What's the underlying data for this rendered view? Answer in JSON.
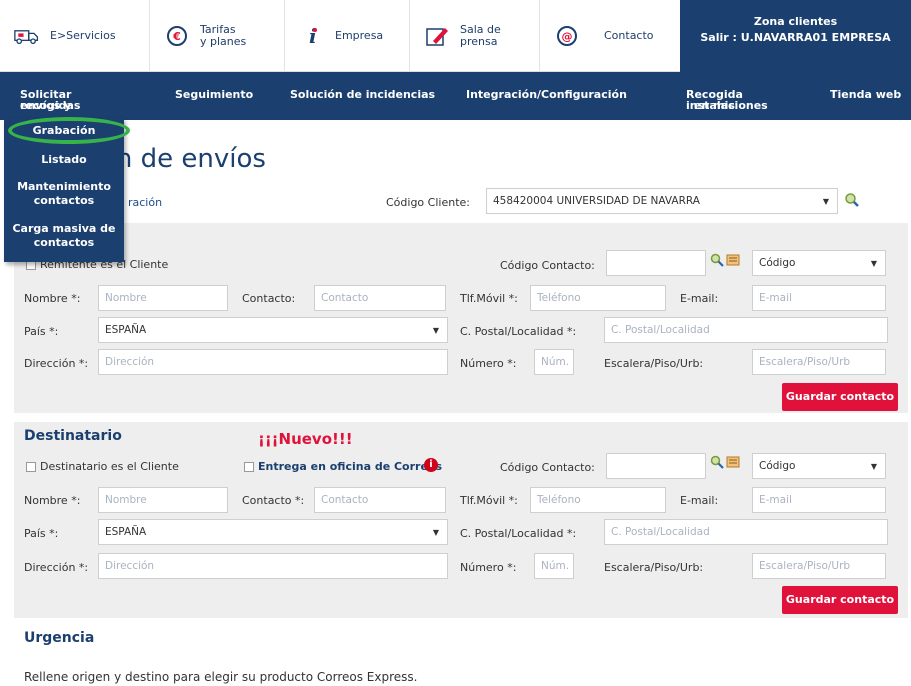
{
  "topbar": {
    "servicios": "E>Servicios",
    "tarifas_l1": "Tarifas",
    "tarifas_l2": "y planes",
    "empresa": "Empresa",
    "sala_l1": "Sala de",
    "sala_l2": "prensa",
    "contacto": "Contacto",
    "zona_title": "Zona clientes",
    "zona_user": "Salir : U.NAVARRA01 EMPRESA"
  },
  "nav": {
    "solicitar_l1": "Solicitar envíos y",
    "solicitar_l2": "recogidas",
    "seguimiento": "Seguimiento",
    "incidencias": "Solución de incidencias",
    "integracion": "Integración/Configuración",
    "recogida_l1": "Recogida en mis",
    "recogida_l2": "instalaciones",
    "tienda": "Tienda web"
  },
  "dropdown": {
    "grabacion": "Grabación",
    "listado": "Listado",
    "mantenimiento_l1": "Mantenimiento",
    "mantenimiento_l2": "contactos",
    "carga_l1": "Carga masiva de",
    "carga_l2": "contactos"
  },
  "page": {
    "title": "ón de envíos",
    "config_link": "ración",
    "codigo_cliente_label": "Código Cliente:",
    "codigo_cliente_value": "458420004 UNIVERSIDAD DE NAVARRA"
  },
  "remitente": {
    "es_cliente": "Remitente es el Cliente",
    "codigo_contacto": "Código Contacto:",
    "codigo_select": "Código",
    "nombre_label": "Nombre *:",
    "nombre_ph": "Nombre",
    "contacto_label": "Contacto:",
    "contacto_ph": "Contacto",
    "tlf_label": "Tlf.Móvil *:",
    "tlf_ph": "Teléfono",
    "email_label": "E-mail:",
    "email_ph": "E-mail",
    "pais_label": "País *:",
    "pais_value": "ESPAÑA",
    "cp_label": "C. Postal/Localidad *:",
    "cp_ph": "C. Postal/Localidad",
    "dir_label": "Dirección *:",
    "dir_ph": "Dirección",
    "num_label": "Número *:",
    "num_ph": "Núm.",
    "esc_label": "Escalera/Piso/Urb:",
    "esc_ph": "Escalera/Piso/Urb",
    "guardar": "Guardar contacto"
  },
  "destinatario": {
    "title": "Destinatario",
    "nuevo": "¡¡¡Nuevo!!!",
    "es_cliente": "Destinatario es el Cliente",
    "oficina": "Entrega en oficina de Correos",
    "codigo_contacto": "Código Contacto:",
    "codigo_select": "Código",
    "nombre_label": "Nombre *:",
    "nombre_ph": "Nombre",
    "contacto_label": "Contacto *:",
    "contacto_ph": "Contacto",
    "tlf_label": "Tlf.Móvil *:",
    "tlf_ph": "Teléfono",
    "email_label": "E-mail:",
    "email_ph": "E-mail",
    "pais_label": "País *:",
    "pais_value": "ESPAÑA",
    "cp_label": "C. Postal/Localidad *:",
    "cp_ph": "C. Postal/Localidad",
    "dir_label": "Dirección *:",
    "dir_ph": "Dirección",
    "num_label": "Número *:",
    "num_ph": "Núm.",
    "esc_label": "Escalera/Piso/Urb:",
    "esc_ph": "Escalera/Piso/Urb",
    "guardar": "Guardar contacto"
  },
  "urgencia": {
    "title": "Urgencia",
    "text": "Rellene origen y destino para elegir su producto Correos Express."
  },
  "colors": {
    "navy": "#1b3f6e",
    "red": "#e0123b",
    "highlight": "#37b34a"
  }
}
